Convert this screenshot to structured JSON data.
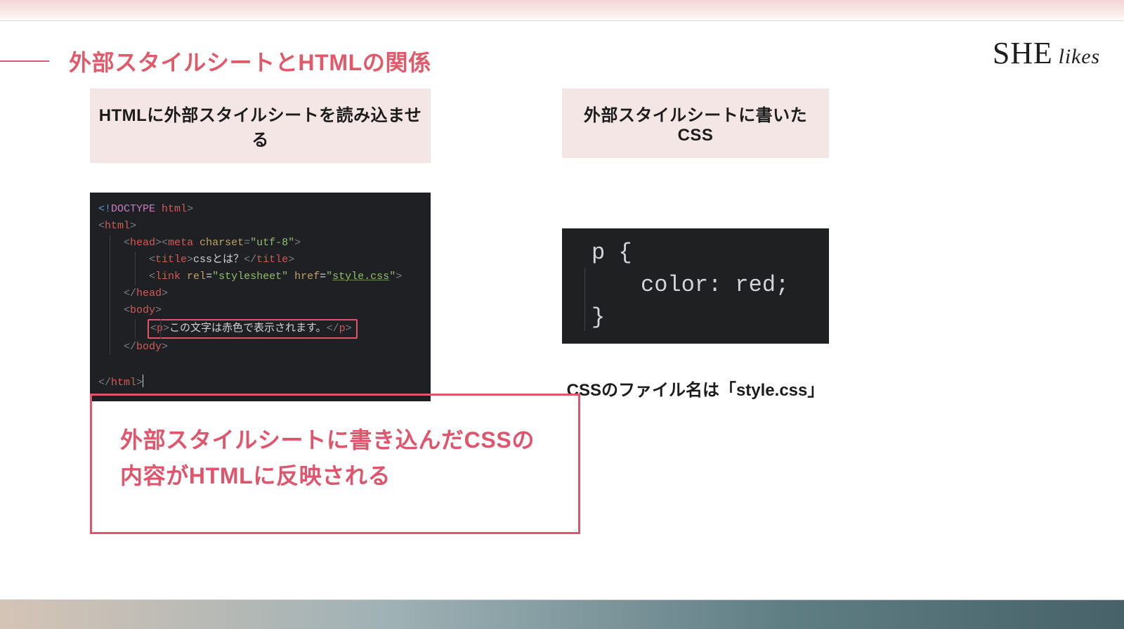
{
  "colors": {
    "accent": "#e0546c",
    "panel": "#f4e6e5",
    "editorBg": "#1f2023"
  },
  "brand": {
    "name": "SHE",
    "sub": "likes"
  },
  "title": "外部スタイルシートとHTMLの関係",
  "left": {
    "label": "HTMLに外部スタイルシートを読み込ませる",
    "code": {
      "doctype_bang": "<!",
      "doctype_word": "DOCTYPE",
      "doctype_html": "html",
      "doctype_close": ">",
      "html_open_l": "<",
      "html_open_t": "html",
      "html_open_r": ">",
      "head_open_l": "<",
      "head_open_t": "head",
      "head_open_r": ">",
      "meta_l": "<",
      "meta_t": "meta",
      "meta_attr": "charset",
      "meta_eq": "=",
      "meta_val": "\"utf-8\"",
      "meta_r": ">",
      "title_open_l": "<",
      "title_open_t": "title",
      "title_open_r": ">",
      "title_text": "cssとは？",
      "title_close_l": "</",
      "title_close_t": "title",
      "title_close_r": ">",
      "link_l": "<",
      "link_t": "link",
      "link_attr1": "rel",
      "link_val1": "\"stylesheet\"",
      "link_attr2": "href",
      "link_val2": "\"",
      "link_val2_file": "style.css",
      "link_val2_end": "\"",
      "link_r": ">",
      "head_close_l": "</",
      "head_close_t": "head",
      "head_close_r": ">",
      "body_open_l": "<",
      "body_open_t": "body",
      "body_open_r": ">",
      "p_open_l": "<",
      "p_open_t": "p",
      "p_open_r": ">",
      "p_text": "この文字は赤色で表示されます。",
      "p_close_l": "</",
      "p_close_t": "p",
      "p_close_r": ">",
      "body_close_l": "</",
      "body_close_t": "body",
      "body_close_r": ">",
      "html_close_l": "</",
      "html_close_t": "html",
      "html_close_r": ">"
    }
  },
  "right": {
    "label": "外部スタイルシートに書いたCSS",
    "css": {
      "selector": "p {",
      "property": "color: red;",
      "close": "}"
    },
    "note": "CSSのファイル名は「style.css」"
  },
  "callout": "外部スタイルシートに書き込んだCSSの内容がHTMLに反映される"
}
